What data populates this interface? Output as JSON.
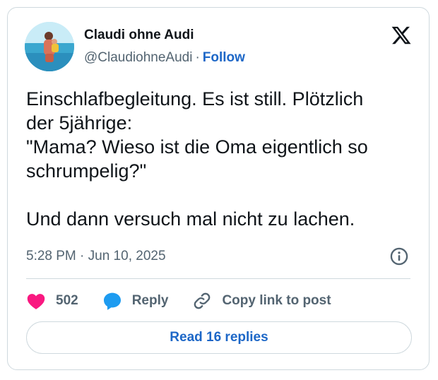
{
  "author": {
    "name": "Claudi ohne Audi",
    "handle": "@ClaudiohneAudi",
    "separator": "·",
    "follow_label": "Follow"
  },
  "tweet": {
    "lines_paragraph_1": [
      "Einschlafbegleitung. Es ist still. Plötzlich",
      "der 5jährige:",
      "\"Mama? Wieso ist die Oma eigentlich so",
      "schrumpelig?\""
    ],
    "paragraph_2": "Und dann versuch mal nicht zu lachen.",
    "timestamp": "5:28 PM · Jun 10, 2025"
  },
  "actions": {
    "like_count": "502",
    "reply_label": "Reply",
    "copy_link_label": "Copy link to post"
  },
  "read_replies_label": "Read 16 replies",
  "colors": {
    "like": "#f91880",
    "reply": "#1d9bf0",
    "link": "#1d67c7",
    "muted": "#536471",
    "border": "#cfd9de"
  }
}
